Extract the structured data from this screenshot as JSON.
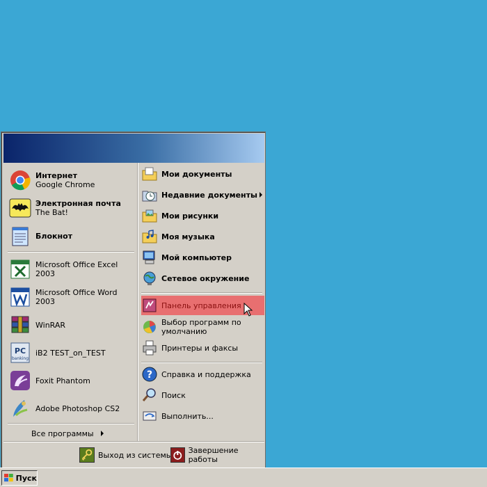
{
  "start_menu": {
    "pinned": [
      {
        "title": "Интернет",
        "subtitle": "Google Chrome",
        "icon": "chrome-icon"
      },
      {
        "title": "Электронная почта",
        "subtitle": "The Bat!",
        "icon": "bat-mail-icon"
      },
      {
        "title": "Блокнот",
        "subtitle": "",
        "icon": "notepad-icon"
      }
    ],
    "recent": [
      {
        "label": "Microsoft Office Excel 2003",
        "icon": "excel-icon"
      },
      {
        "label": "Microsoft Office Word 2003",
        "icon": "word-icon"
      },
      {
        "label": "WinRAR",
        "icon": "winrar-icon"
      },
      {
        "label": "iB2 TEST_on_TEST",
        "icon": "pc-banking-icon"
      },
      {
        "label": "Foxit Phantom",
        "icon": "foxit-icon"
      },
      {
        "label": "Adobe Photoshop CS2",
        "icon": "photoshop-icon"
      }
    ],
    "all_programs": "Все программы",
    "places": [
      {
        "label": "Мои документы",
        "icon": "my-documents-icon"
      },
      {
        "label": "Недавние документы",
        "icon": "recent-documents-icon"
      },
      {
        "label": "Мои рисунки",
        "icon": "my-pictures-icon"
      },
      {
        "label": "Моя музыка",
        "icon": "my-music-icon"
      },
      {
        "label": "Мой компьютер",
        "icon": "my-computer-icon"
      },
      {
        "label": "Сетевое окружение",
        "icon": "network-icon"
      }
    ],
    "system": [
      {
        "label": "Панель управления",
        "icon": "control-panel-icon"
      },
      {
        "label": "Выбор программ по",
        "label2": "умолчанию",
        "icon": "default-programs-icon"
      },
      {
        "label": "Принтеры и факсы",
        "icon": "printer-icon"
      }
    ],
    "help": [
      {
        "label": "Справка и поддержка",
        "icon": "help-icon"
      },
      {
        "label": "Поиск",
        "icon": "search-icon"
      },
      {
        "label": "Выполнить...",
        "icon": "run-icon"
      }
    ],
    "logoff": "Выход из системы",
    "shutdown": "Завершение работы"
  },
  "taskbar": {
    "start_label": "Пуск"
  },
  "colors": {
    "desktop": "#3ba7d4",
    "menu_bg": "#d4d0c8",
    "highlight": "#e86f70"
  }
}
